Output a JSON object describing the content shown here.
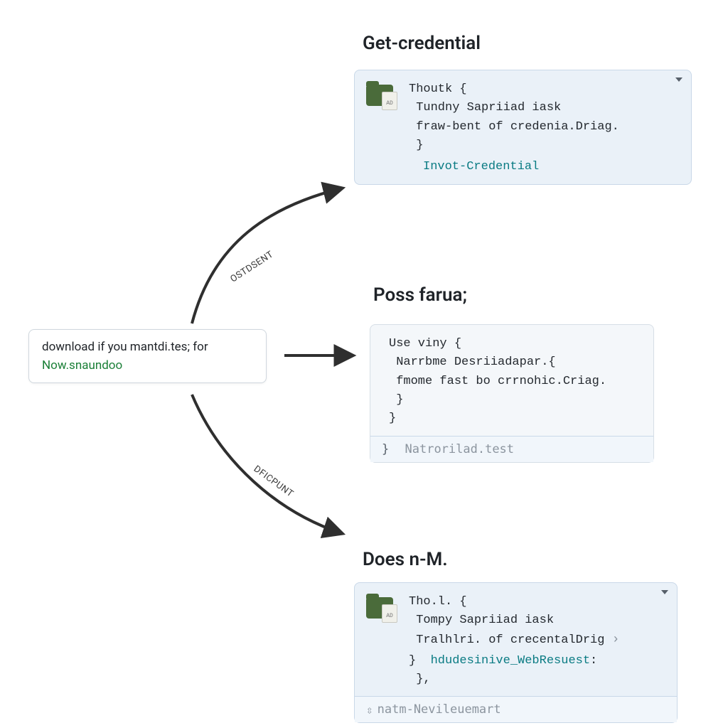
{
  "source": {
    "line1": "download if you mantdi.tes; for",
    "line2": "Now.snaundoo"
  },
  "arrows": {
    "label_top": "OSTDSENT",
    "label_bottom": "DFICPUNT"
  },
  "cards": [
    {
      "title": "Get-credential",
      "code": "Thoutk {\n Tundny Sapriiad iask\n fraw-bent of credenia.Driag.\n }",
      "highlight": "Invot-Credential",
      "has_icon": true,
      "has_dropdown": true,
      "sheet_text": "AD"
    },
    {
      "title": "Poss farua;",
      "code": "Use viny {\n Narrbme Desriiadapar.{\n fmome fast bo crrnohic.Criag.\n }\n}",
      "footer_text": "Natrorilad.test",
      "has_icon": false,
      "has_dropdown": false
    },
    {
      "title": "Does n-M.",
      "code": "Tho.l. {\n Tompy Sapriiad iask\n Tralhlri. of crecentalDrig",
      "highlight": "hdudesinive_WebResuest",
      "code_tail": ":\n },",
      "has_icon": true,
      "has_dropdown": true,
      "has_chevron_right": true,
      "footer_icon": "updown",
      "footer_text": "natm-Nevileuemart",
      "sheet_text": "AD"
    }
  ]
}
